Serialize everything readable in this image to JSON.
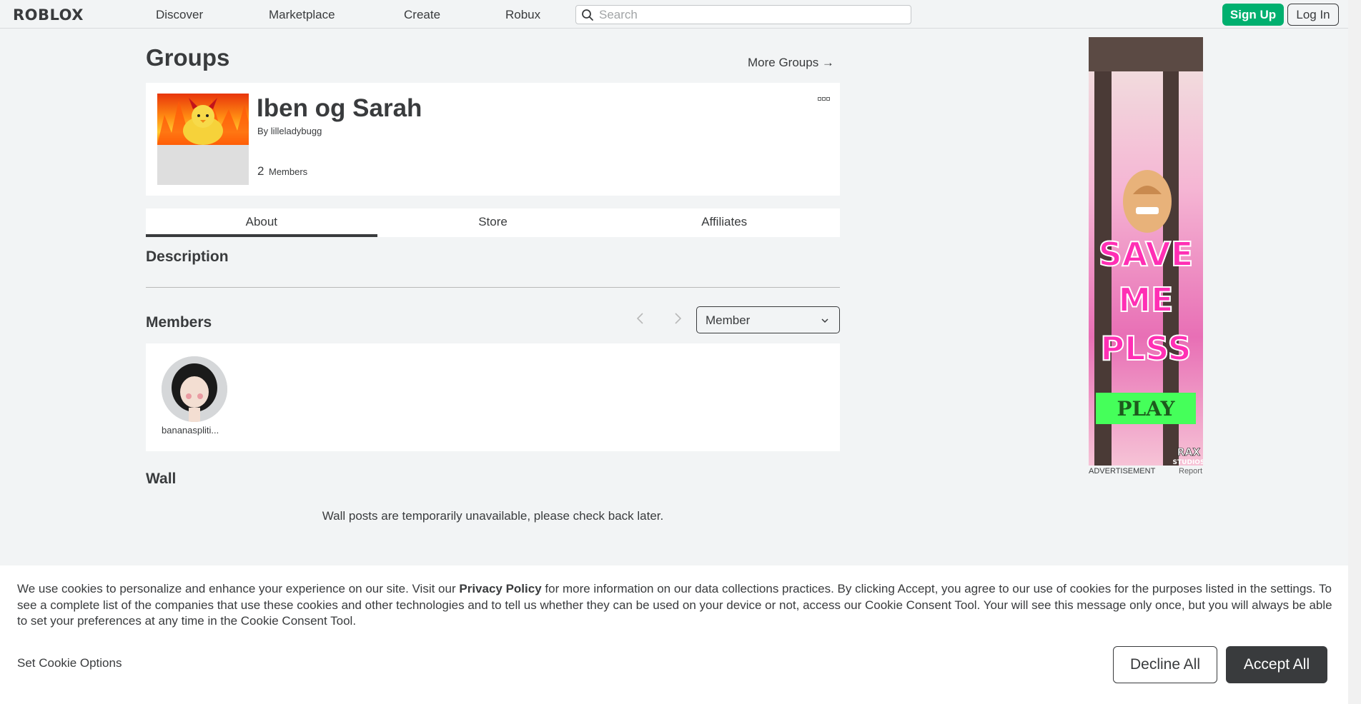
{
  "header": {
    "logo": "ROBLOX",
    "nav": [
      "Discover",
      "Marketplace",
      "Create",
      "Robux"
    ],
    "search_placeholder": "Search",
    "signup_label": "Sign Up",
    "login_label": "Log In"
  },
  "page": {
    "title": "Groups",
    "more_groups": "More Groups →"
  },
  "group": {
    "name": "Iben og Sarah",
    "by_prefix": "By",
    "owner": "lilleladybugg",
    "member_count": "2",
    "members_label": "Members",
    "more_icon": "ellipsis-icon"
  },
  "tabs": [
    "About",
    "Store",
    "Affiliates"
  ],
  "about": {
    "description_heading": "Description",
    "members_heading": "Members",
    "role_select": "Member",
    "members": [
      {
        "name": "bananaspliti..."
      }
    ],
    "wall_heading": "Wall",
    "wall_message": "Wall posts are temporarily unavailable, please check back later."
  },
  "ad": {
    "headline_lines": [
      "SAVE",
      "ME",
      "PLSS"
    ],
    "cta": "PLAY",
    "brand_top": "RAX",
    "brand_bottom": "STUDIOS",
    "label": "ADVERTISEMENT",
    "report": "Report",
    "colors": {
      "headline": "#ff2fb4",
      "cta_bg": "#45ff5a",
      "bg": "#f3a6cf"
    }
  },
  "cookie_banner": {
    "text_before": "We use cookies to personalize and enhance your experience on our site. Visit our ",
    "privacy_link": "Privacy Policy",
    "text_after": " for more information on our data collections practices. By clicking Accept, you agree to our use of cookies for the purposes listed in the settings. To see a complete list of the companies that use these cookies and other technologies and to tell us whether they can be used on your device or not, access our Cookie Consent Tool. Your will see this message only once, but you will always be able to set your preferences at any time in the Cookie Consent Tool.",
    "set_options": "Set Cookie Options",
    "decline": "Decline All",
    "accept": "Accept All"
  },
  "colors": {
    "signup_green": "#00b06f",
    "text": "#393b3d",
    "page_bg": "#f2f4f5"
  }
}
